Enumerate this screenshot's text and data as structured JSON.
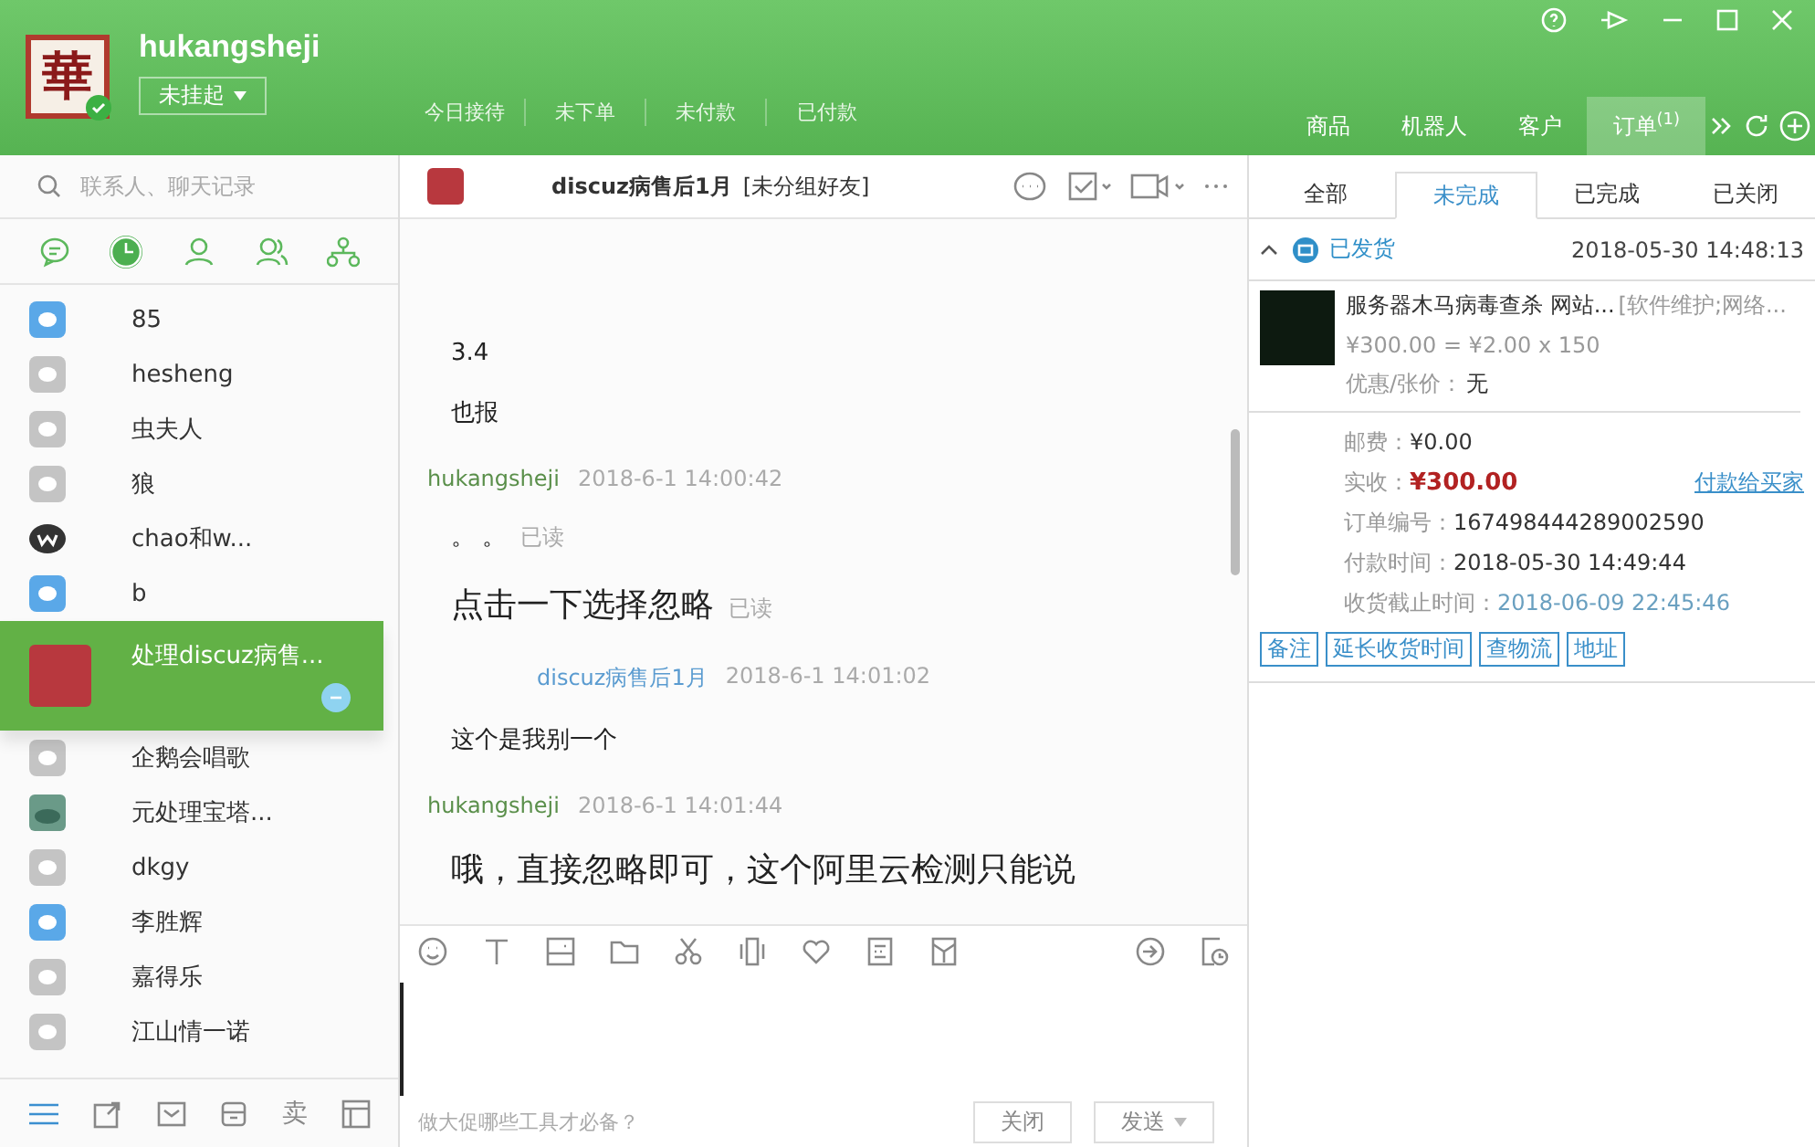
{
  "header": {
    "logo_text": "華",
    "username": "hukangsheji",
    "status": "未挂起",
    "stats": [
      {
        "label": "今日接待"
      },
      {
        "label": "未下单"
      },
      {
        "label": "未付款"
      },
      {
        "label": "已付款"
      }
    ],
    "nav": [
      {
        "label": "商品",
        "selected": false
      },
      {
        "label": "机器人",
        "selected": false
      },
      {
        "label": "客户",
        "selected": false
      },
      {
        "label": "订单",
        "selected": true,
        "badge": "(1)"
      }
    ]
  },
  "sidebar": {
    "search_placeholder": "联系人、聊天记录",
    "tabs": [
      {
        "kind": "chat",
        "selected": false
      },
      {
        "kind": "recent",
        "selected": true
      },
      {
        "kind": "contact",
        "selected": false
      },
      {
        "kind": "group",
        "selected": false
      },
      {
        "kind": "org",
        "selected": false
      }
    ],
    "contacts": [
      {
        "name": "85",
        "kind": "blue",
        "selected": false
      },
      {
        "name": "hesheng",
        "kind": "gray",
        "selected": false
      },
      {
        "name": "虫夫人",
        "kind": "gray",
        "selected": false
      },
      {
        "name": "狼",
        "kind": "gray",
        "selected": false
      },
      {
        "name": "chao和w...",
        "kind": "dark",
        "selected": false
      },
      {
        "name": "b",
        "kind": "blue",
        "selected": false
      },
      {
        "name": "处理discuz病售...",
        "kind": "photo",
        "selected": true
      },
      {
        "name": "企鹅会唱歌",
        "kind": "gray",
        "selected": false
      },
      {
        "name": "元处理宝塔...",
        "kind": "photo2",
        "selected": false
      },
      {
        "name": "dkgy",
        "kind": "gray",
        "selected": false
      },
      {
        "name": "李胜辉",
        "kind": "blue",
        "selected": false
      },
      {
        "name": "嘉得乐",
        "kind": "gray",
        "selected": false
      },
      {
        "name": "江山情一诺",
        "kind": "gray",
        "selected": false
      }
    ],
    "bottom_tool_label": "卖"
  },
  "chat": {
    "title": "discuz病售后1月",
    "group": "[未分组好友]",
    "messages": [
      {
        "kind": "text",
        "text": "3.4"
      },
      {
        "kind": "text",
        "text": "也报"
      },
      {
        "kind": "sender",
        "name": "hukangsheji",
        "time": "2018-6-1 14:00:42",
        "self": true
      },
      {
        "kind": "text",
        "text": "。 。",
        "read": "已读"
      },
      {
        "kind": "big",
        "text": "点击一下选择忽略",
        "read": "已读"
      },
      {
        "kind": "sender",
        "name": "discuz病售后1月",
        "time": "2018-6-1 14:01:02",
        "self": false
      },
      {
        "kind": "text",
        "text": "这个是我别一个"
      },
      {
        "kind": "sender",
        "name": "hukangsheji",
        "time": "2018-6-1 14:01:44",
        "self": true
      },
      {
        "kind": "big",
        "text": "哦，直接忽略即可，这个阿里云检测只能说"
      }
    ],
    "ad": "做大促哪些工具才必备？",
    "buttons": [
      {
        "label": "关闭",
        "dropdown": false
      },
      {
        "label": "发送",
        "dropdown": true
      }
    ]
  },
  "order_panel": {
    "tabs": [
      {
        "label": "全部",
        "selected": false
      },
      {
        "label": "未完成",
        "selected": true
      },
      {
        "label": "已完成",
        "selected": false
      },
      {
        "label": "已关闭",
        "selected": false
      }
    ],
    "order": {
      "status": "已发货",
      "time": "2018-05-30 14:48:13",
      "product": "服务器木马病毒查杀 网站...",
      "category": "[软件维护;网络...",
      "price": "¥300.00 = ¥2.00 x 150",
      "discount_label": "优惠/张价：",
      "discount": "无",
      "fields": [
        {
          "label": "邮费：",
          "value": "¥0.00",
          "kind": "plain"
        },
        {
          "label": "实收：",
          "value": "¥300.00",
          "kind": "amount",
          "link": "付款给买家"
        },
        {
          "label": "订单编号：",
          "value": "167498444289002590",
          "kind": "plain"
        },
        {
          "label": "付款时间：",
          "value": "2018-05-30 14:49:44",
          "kind": "plain"
        },
        {
          "label": "收货截止时间：",
          "value": "2018-06-09 22:45:46",
          "kind": "muted"
        }
      ],
      "actions": [
        "备注",
        "延长收货时间",
        "查物流",
        "地址"
      ]
    }
  }
}
